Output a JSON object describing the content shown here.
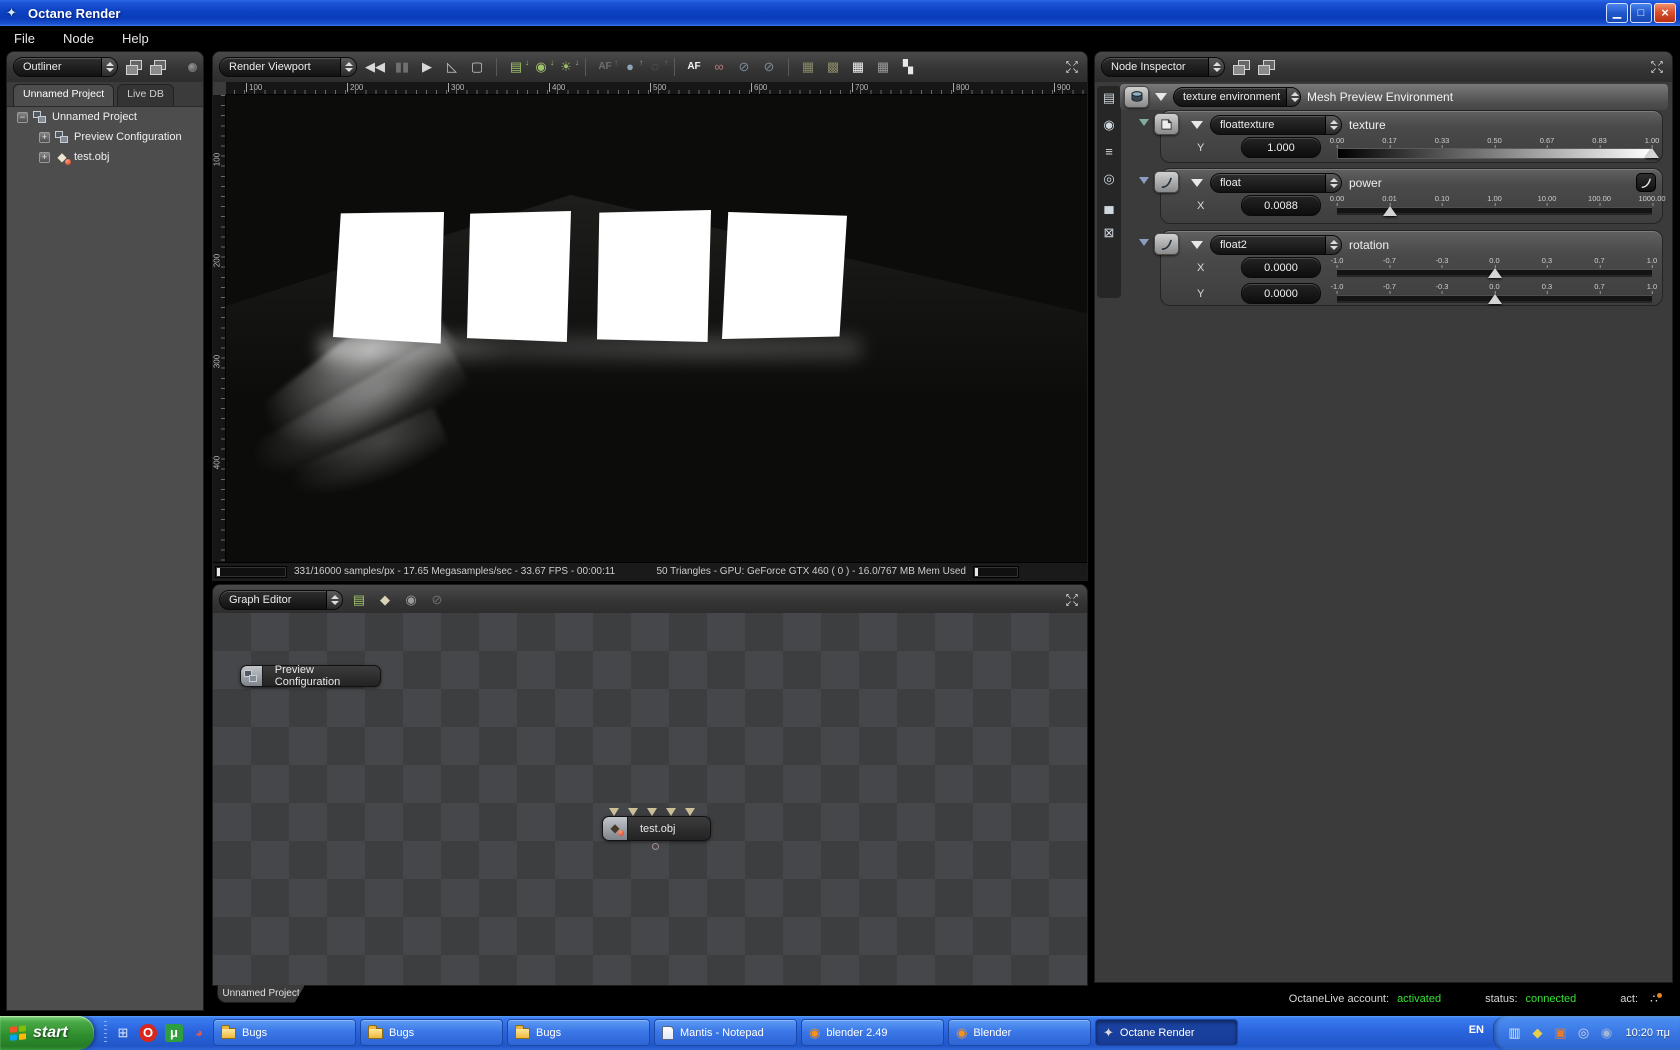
{
  "window": {
    "title": "Octane Render",
    "icon_glyph": "✦",
    "minimize_glyph": "▁",
    "maximize_glyph": "□",
    "close_glyph": "×"
  },
  "menu": {
    "items": [
      "File",
      "Node",
      "Help"
    ]
  },
  "expand_glyph": "↖↗\n↙↘",
  "outliner": {
    "selector": "Outliner",
    "tabs": [
      {
        "label": "Unnamed Project",
        "active": true
      },
      {
        "label": "Live DB",
        "active": false
      }
    ],
    "tree": [
      {
        "expander": "−",
        "icon": "graph-node-icon",
        "label": "Unnamed Project",
        "indent": 0
      },
      {
        "expander": "+",
        "icon": "graph-node-icon",
        "label": "Preview Configuration",
        "indent": 1
      },
      {
        "expander": "+",
        "icon": "mesh-icon",
        "label": "test.obj",
        "indent": 1
      }
    ]
  },
  "viewport": {
    "selector": "Render Viewport",
    "toolbar": [
      {
        "name": "restart-render-icon",
        "glyph": "◀◀",
        "color": "#d8d8d8"
      },
      {
        "name": "pause-render-icon",
        "glyph": "▮▮",
        "color": "#6f6f6f"
      },
      {
        "name": "play-render-icon",
        "glyph": "▶",
        "color": "#d8d8d8"
      },
      {
        "name": "ruler-icon",
        "glyph": "◺",
        "color": "#c8c8c8"
      },
      {
        "name": "region-render-icon",
        "glyph": "▢",
        "color": "#c8c8c8"
      },
      {
        "sep": true
      },
      {
        "name": "save-image-icon",
        "glyph": "▤",
        "color": "#9fc36a",
        "badge": "↓"
      },
      {
        "name": "save-render-state-icon",
        "glyph": "◉",
        "color": "#9fc36a",
        "badge": "↓"
      },
      {
        "name": "save-lighting-icon",
        "glyph": "☀",
        "color": "#9fc36a",
        "badge": "↓"
      },
      {
        "sep": true
      },
      {
        "name": "load-af-icon",
        "glyph": "AF",
        "color": "#6f6f6f",
        "badge": "↑"
      },
      {
        "name": "load-render-state-icon",
        "glyph": "●",
        "color": "#8fa3b8",
        "badge": "↑"
      },
      {
        "name": "pick-focus-icon",
        "glyph": "◌",
        "color": "#6f6f6f",
        "badge": "↑"
      },
      {
        "sep": true
      },
      {
        "name": "autofocus-icon",
        "glyph": "AF",
        "color": "#f2f2f2"
      },
      {
        "name": "stereo-glasses-icon",
        "glyph": "∞",
        "color": "#b87878"
      },
      {
        "name": "sphere-disabled-icon",
        "glyph": "⊘",
        "color": "#7a8a99"
      },
      {
        "name": "sphere-disabled2-icon",
        "glyph": "⊘",
        "color": "#7a8a99"
      },
      {
        "sep": true
      },
      {
        "name": "alpha-channel-icon",
        "glyph": "▦",
        "color": "#8a8a6a"
      },
      {
        "name": "alpha-shadows-icon",
        "glyph": "▩",
        "color": "#8a8a6a"
      },
      {
        "name": "checker-white-icon",
        "glyph": "▦",
        "color": "#f2f2f2"
      },
      {
        "name": "checker-gray-icon",
        "glyph": "▦",
        "color": "#9a9a9a"
      },
      {
        "name": "checker-bw-icon",
        "glyph": "▚",
        "color": "#e8e8e8"
      }
    ],
    "ruler_h": [
      "100",
      "200",
      "300",
      "400",
      "500",
      "600",
      "700",
      "800",
      "900"
    ],
    "ruler_v": [
      "100",
      "200",
      "300",
      "400"
    ],
    "status_left": "331/16000 samples/px - 17.65 Megasamples/sec - 33.67 FPS - 00:00:11",
    "status_right": "50 Triangles - GPU: GeForce GTX 460 ( 0 ) - 16.0/767 MB Mem Used"
  },
  "graph": {
    "selector": "Graph Editor",
    "toolbar": [
      {
        "name": "save-image-icon",
        "glyph": "▤",
        "color": "#9fc36a"
      },
      {
        "name": "mesh-node-icon",
        "glyph": "◆",
        "color": "#d8d2b8"
      },
      {
        "name": "material-ball-icon",
        "glyph": "◉",
        "color": "#9a9a9a"
      },
      {
        "name": "disabled-ball-icon",
        "glyph": "⊘",
        "color": "#6f6f6f"
      }
    ],
    "nodes": [
      {
        "label": "Preview Configuration"
      },
      {
        "label": "test.obj"
      }
    ],
    "bottom_tab": "Unnamed Project"
  },
  "inspector": {
    "selector": "Node Inspector",
    "side_icons": [
      {
        "name": "render-preview-icon",
        "glyph": "▤",
        "color": "#cfd8df"
      },
      {
        "name": "camera-preview-icon",
        "glyph": "◉",
        "color": "#cfd8df"
      },
      {
        "name": "layers-icon",
        "glyph": "≡",
        "color": "#cfd8df"
      },
      {
        "name": "material-preview-icon",
        "glyph": "◎",
        "color": "#cfd8df"
      },
      {
        "name": "histogram-icon",
        "glyph": "▄",
        "color": "#cfd8df"
      },
      {
        "name": "no-preview-icon",
        "glyph": "⊠",
        "color": "#cfd8df"
      }
    ],
    "env": {
      "type_label": "texture environment",
      "name_label": "Mesh Preview Environment"
    },
    "groups": [
      {
        "type_label": "floattexture",
        "name_label": "texture",
        "rows": [
          {
            "axis": "Y",
            "value": "1.000",
            "ticks": [
              "0.00",
              "0.17",
              "0.33",
              "0.50",
              "0.67",
              "0.83",
              "1.00"
            ],
            "handle": 1,
            "gradient": true
          }
        ]
      },
      {
        "type_label": "float",
        "name_label": "power",
        "curve_button": true,
        "rows": [
          {
            "axis": "X",
            "value": "0.0088",
            "ticks": [
              "0.00",
              "0.01",
              "0.10",
              "1.00",
              "10.00",
              "100.00",
              "1000.00"
            ],
            "handle": 0.167
          }
        ]
      },
      {
        "type_label": "float2",
        "name_label": "rotation",
        "rows": [
          {
            "axis": "X",
            "value": "0.0000",
            "ticks": [
              "-1.0",
              "-0.7",
              "-0.3",
              "0.0",
              "0.3",
              "0.7",
              "1.0"
            ],
            "handle": 0.5
          },
          {
            "axis": "Y",
            "value": "0.0000",
            "ticks": [
              "-1.0",
              "-0.7",
              "-0.3",
              "0.0",
              "0.3",
              "0.7",
              "1.0"
            ],
            "handle": 0.5
          }
        ]
      }
    ],
    "live": {
      "account_label": "OctaneLive account:",
      "account_value": "activated",
      "status_label": "status:",
      "status_value": "connected",
      "act_label": "act:",
      "ok_color": "#35e035"
    }
  },
  "taskbar": {
    "start_label": "start",
    "quick_launch": [
      {
        "name": "quick-launch-app1-icon",
        "glyph": "⊞",
        "color": "#d8e8ff"
      },
      {
        "name": "opera-icon",
        "glyph": "O",
        "color": "#ffffff",
        "bg": "#d8271c",
        "round": true
      },
      {
        "name": "mantis-icon",
        "glyph": "μ",
        "color": "#ffffff",
        "bg": "#2f9e3f"
      },
      {
        "name": "quick-launch-app4-icon",
        "glyph": "◕",
        "color": "#e05a4a"
      }
    ],
    "buttons": [
      {
        "label": "Bugs",
        "icon": "folder"
      },
      {
        "label": "Bugs",
        "icon": "folder"
      },
      {
        "label": "Bugs",
        "icon": "folder"
      },
      {
        "label": "Mantis - Notepad",
        "icon": "notepad"
      },
      {
        "label": "blender 2.49",
        "icon": "blender",
        "glyph": "◉",
        "color": "#f5921f"
      },
      {
        "label": "Blender",
        "icon": "blender",
        "glyph": "◉",
        "color": "#f5921f"
      },
      {
        "label": "Octane Render",
        "icon": "octane",
        "glyph": "✦",
        "color": "#d8d8d8",
        "active": true
      }
    ],
    "language": "EN",
    "tray_icons": [
      {
        "name": "tray-doc-icon",
        "glyph": "▥",
        "color": "#d8e6f8"
      },
      {
        "name": "tray-shield-icon",
        "glyph": "◆",
        "color": "#e8cf4a"
      },
      {
        "name": "tray-app-icon",
        "glyph": "▣",
        "color": "#e87a2a"
      },
      {
        "name": "tray-update-icon",
        "glyph": "◎",
        "color": "#d8d8d8"
      },
      {
        "name": "tray-octane-icon",
        "glyph": "◉",
        "color": "#9fb8d8"
      }
    ],
    "clock": "10:20 πμ"
  }
}
